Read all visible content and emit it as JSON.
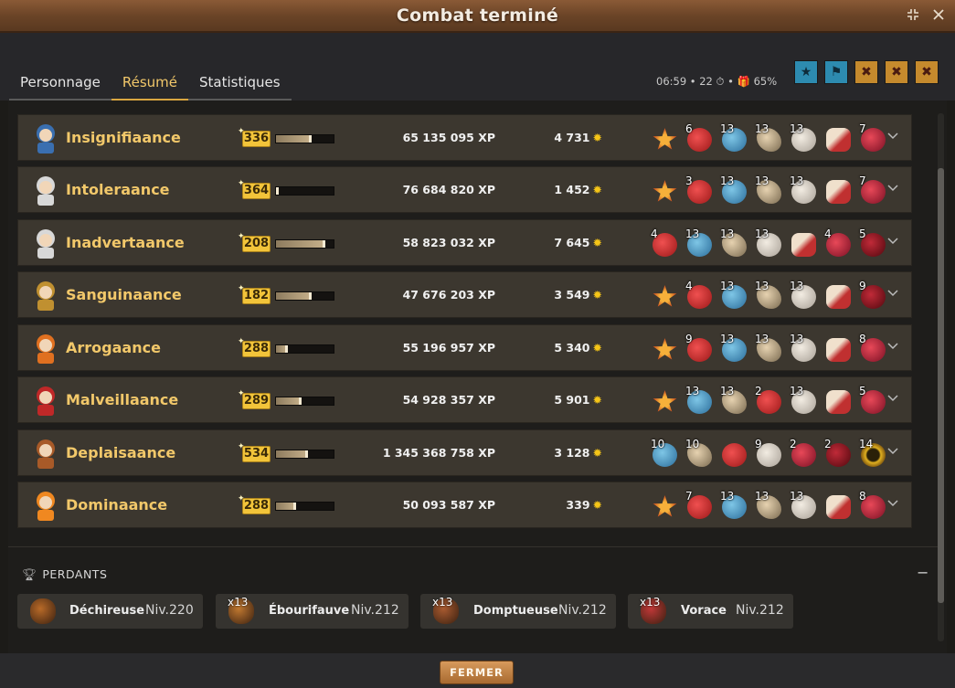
{
  "window": {
    "title": "Combat terminé",
    "minimize_icon": "collapse-icon",
    "close_icon": "close-icon"
  },
  "tabs": [
    {
      "label": "Personnage",
      "active": false
    },
    {
      "label": "Résumé",
      "active": true
    },
    {
      "label": "Statistiques",
      "active": false
    }
  ],
  "fight_stats": {
    "duration": "06:59",
    "turns": "22",
    "bonus": "65%",
    "text": "06:59 • 22 ⏱ • 🎁 65%"
  },
  "challenges": [
    {
      "icon": "challenge-star-icon",
      "color": "#2d8bb0"
    },
    {
      "icon": "challenge-duel-icon",
      "color": "#2d8bb0"
    },
    {
      "icon": "challenge-failed-icon",
      "color": "#c58a2d"
    },
    {
      "icon": "challenge-failed-icon",
      "color": "#c58a2d"
    },
    {
      "icon": "challenge-failed-icon",
      "color": "#c58a2d"
    }
  ],
  "players": [
    {
      "name": "Insignifiaance",
      "level": "336",
      "xp_progress": 0.62,
      "xp": "65 135 095 XP",
      "kamas": "4 731",
      "avatar": "#3a6fb0",
      "loot": [
        {
          "q": "",
          "t": "star"
        },
        {
          "q": "6",
          "t": "red"
        },
        {
          "q": "13",
          "t": "blue"
        },
        {
          "q": "13",
          "t": "horn"
        },
        {
          "q": "13",
          "t": "bone"
        },
        {
          "q": "",
          "t": "claw"
        },
        {
          "q": "7",
          "t": "heart"
        }
      ]
    },
    {
      "name": "Intoleraance",
      "level": "364",
      "xp_progress": 0.05,
      "xp": "76 684 820 XP",
      "kamas": "1 452",
      "avatar": "#d8d8d8",
      "loot": [
        {
          "q": "",
          "t": "star"
        },
        {
          "q": "3",
          "t": "red"
        },
        {
          "q": "13",
          "t": "blue"
        },
        {
          "q": "13",
          "t": "horn"
        },
        {
          "q": "13",
          "t": "bone"
        },
        {
          "q": "",
          "t": "claw"
        },
        {
          "q": "7",
          "t": "heart"
        }
      ]
    },
    {
      "name": "Inadvertaance",
      "level": "208",
      "xp_progress": 0.86,
      "xp": "58 823 032 XP",
      "kamas": "7 645",
      "avatar": "#d8d8d8",
      "loot": [
        {
          "q": "4",
          "t": "red"
        },
        {
          "q": "13",
          "t": "blue"
        },
        {
          "q": "13",
          "t": "horn"
        },
        {
          "q": "13",
          "t": "bone"
        },
        {
          "q": "",
          "t": "claw"
        },
        {
          "q": "4",
          "t": "heart"
        },
        {
          "q": "5",
          "t": "dark"
        }
      ]
    },
    {
      "name": "Sanguinaance",
      "level": "182",
      "xp_progress": 0.62,
      "xp": "47 676 203 XP",
      "kamas": "3 549",
      "avatar": "#c09030",
      "loot": [
        {
          "q": "",
          "t": "star"
        },
        {
          "q": "4",
          "t": "red"
        },
        {
          "q": "13",
          "t": "blue"
        },
        {
          "q": "13",
          "t": "horn"
        },
        {
          "q": "13",
          "t": "bone"
        },
        {
          "q": "",
          "t": "claw"
        },
        {
          "q": "9",
          "t": "dark"
        }
      ]
    },
    {
      "name": "Arrogaance",
      "level": "288",
      "xp_progress": 0.2,
      "xp": "55 196 957 XP",
      "kamas": "5 340",
      "avatar": "#e07020",
      "loot": [
        {
          "q": "",
          "t": "star"
        },
        {
          "q": "9",
          "t": "red"
        },
        {
          "q": "13",
          "t": "blue"
        },
        {
          "q": "13",
          "t": "horn"
        },
        {
          "q": "13",
          "t": "bone"
        },
        {
          "q": "",
          "t": "claw"
        },
        {
          "q": "8",
          "t": "heart"
        }
      ]
    },
    {
      "name": "Malveillaance",
      "level": "289",
      "xp_progress": 0.45,
      "xp": "54 928 357 XP",
      "kamas": "5 901",
      "avatar": "#c02828",
      "loot": [
        {
          "q": "",
          "t": "star"
        },
        {
          "q": "13",
          "t": "blue"
        },
        {
          "q": "13",
          "t": "horn"
        },
        {
          "q": "2",
          "t": "red"
        },
        {
          "q": "13",
          "t": "bone"
        },
        {
          "q": "",
          "t": "claw"
        },
        {
          "q": "5",
          "t": "heart"
        }
      ]
    },
    {
      "name": "Deplaisaance",
      "level": "534",
      "xp_progress": 0.55,
      "xp": "1 345 368 758 XP",
      "kamas": "3 128",
      "avatar": "#a85a28",
      "loot": [
        {
          "q": "10",
          "t": "blue"
        },
        {
          "q": "10",
          "t": "horn"
        },
        {
          "q": "",
          "t": "red"
        },
        {
          "q": "9",
          "t": "bone"
        },
        {
          "q": "2",
          "t": "heart"
        },
        {
          "q": "2",
          "t": "dark"
        },
        {
          "q": "14",
          "t": "ring"
        }
      ]
    },
    {
      "name": "Dominaance",
      "level": "288",
      "xp_progress": 0.35,
      "xp": "50 093 587 XP",
      "kamas": "339",
      "avatar": "#f08820",
      "loot": [
        {
          "q": "",
          "t": "star"
        },
        {
          "q": "7",
          "t": "red"
        },
        {
          "q": "13",
          "t": "blue"
        },
        {
          "q": "13",
          "t": "horn"
        },
        {
          "q": "13",
          "t": "bone"
        },
        {
          "q": "",
          "t": "claw"
        },
        {
          "q": "8",
          "t": "heart"
        }
      ]
    }
  ],
  "losers": {
    "title": "PERDANTS",
    "collapse_label": "−",
    "items": [
      {
        "name": "Déchireuse",
        "level": "Niv.220",
        "qty": "",
        "color": "#b86a28"
      },
      {
        "name": "Ébourifauve",
        "level": "Niv.212",
        "qty": "x13",
        "color": "#c07830"
      },
      {
        "name": "Domptueuse",
        "level": "Niv.212",
        "qty": "x13",
        "color": "#a85a30"
      },
      {
        "name": "Vorace",
        "level": "Niv.212",
        "qty": "x13",
        "color": "#c03838"
      }
    ]
  },
  "footer": {
    "close_label": "FERMER"
  }
}
